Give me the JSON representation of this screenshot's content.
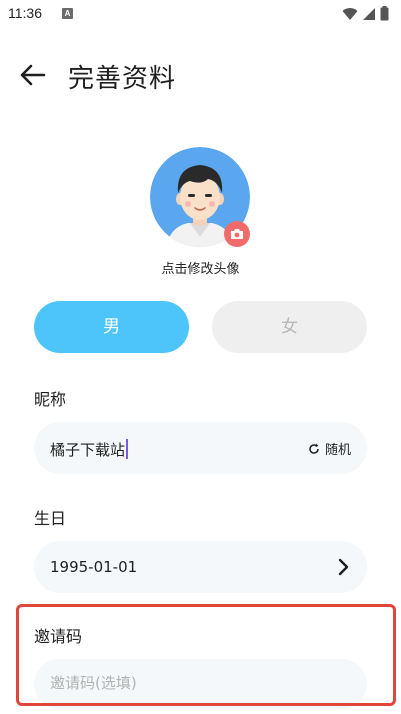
{
  "status_bar": {
    "time": "11:36",
    "notification_glyph": "A",
    "icons": [
      "wifi-icon",
      "signal-icon",
      "battery-icon"
    ]
  },
  "header": {
    "title": "完善资料",
    "back_icon": "arrow-left-icon"
  },
  "avatar": {
    "caption": "点击修改头像",
    "badge_icon": "camera-icon",
    "badge_color": "#f26b6b",
    "bg_color": "#5aa7f0"
  },
  "gender": {
    "male_label": "男",
    "female_label": "女",
    "selected": "男",
    "active_color": "#4dc5fb"
  },
  "nickname": {
    "label": "昵称",
    "value": "橘子下载站",
    "random_label": "随机",
    "random_icon": "refresh-icon"
  },
  "birthday": {
    "label": "生日",
    "value": "1995-01-01",
    "chevron_icon": "chevron-right-icon"
  },
  "invite": {
    "label": "邀请码",
    "placeholder": "邀请码(选填)",
    "value": "",
    "highlight_color": "#e0463a"
  }
}
